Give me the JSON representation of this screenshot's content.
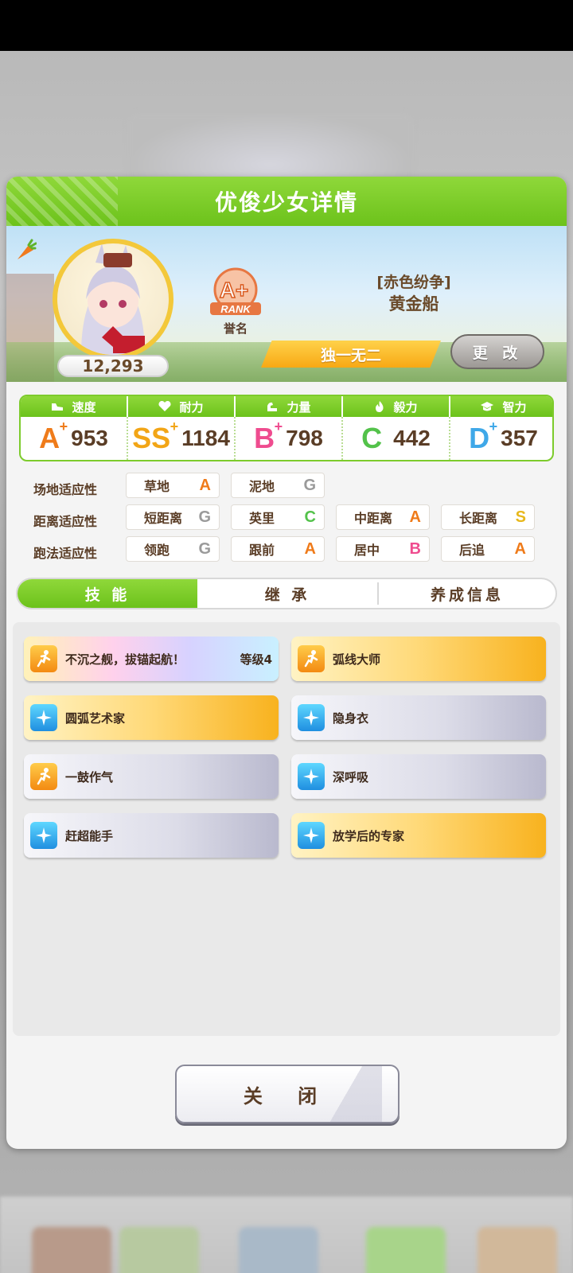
{
  "dialog": {
    "title": "优俊少女详情"
  },
  "character": {
    "fans": "12,293",
    "rank": "A+",
    "rank_word": "RANK",
    "rank_label": "誉名",
    "epithet": "[赤色纷争]",
    "name": "黄金船",
    "title_bar": "独一无二",
    "change_label": "更 改"
  },
  "stats": [
    {
      "label": "速度",
      "grade": "A",
      "plus": "+",
      "value": "953",
      "color": "#ef7b1a",
      "icon": "shoe-icon"
    },
    {
      "label": "耐力",
      "grade": "SS",
      "plus": "+",
      "value": "1184",
      "color": "#f2a516",
      "icon": "heart-icon"
    },
    {
      "label": "力量",
      "grade": "B",
      "plus": "+",
      "value": "798",
      "color": "#ef4c8f",
      "icon": "arm-icon"
    },
    {
      "label": "毅力",
      "grade": "C",
      "plus": "",
      "value": "442",
      "color": "#53c24a",
      "icon": "flame-icon"
    },
    {
      "label": "智力",
      "grade": "D",
      "plus": "+",
      "value": "357",
      "color": "#3fa8e8",
      "icon": "graduation-cap-icon"
    }
  ],
  "aptitude": {
    "rows": [
      {
        "label": "场地适应性",
        "cells": [
          {
            "name": "草地",
            "grade": "A"
          },
          {
            "name": "泥地",
            "grade": "G"
          }
        ]
      },
      {
        "label": "距离适应性",
        "cells": [
          {
            "name": "短距离",
            "grade": "G"
          },
          {
            "name": "英里",
            "grade": "C"
          },
          {
            "name": "中距离",
            "grade": "A"
          },
          {
            "name": "长距离",
            "grade": "S"
          }
        ]
      },
      {
        "label": "跑法适应性",
        "cells": [
          {
            "name": "领跑",
            "grade": "G"
          },
          {
            "name": "跟前",
            "grade": "A"
          },
          {
            "name": "居中",
            "grade": "B"
          },
          {
            "name": "后追",
            "grade": "A"
          }
        ]
      }
    ]
  },
  "tabs": [
    {
      "label": "技 能",
      "active": true
    },
    {
      "label": "继 承",
      "active": false
    },
    {
      "label": "养成信息",
      "active": false
    }
  ],
  "skills": [
    {
      "name": "不沉之舰，拔锚起航！",
      "level": "等级4",
      "style": "rainbow",
      "icon": "runner-icon",
      "icon_color": "orange"
    },
    {
      "name": "弧线大师",
      "level": "",
      "style": "gold",
      "icon": "runner-icon",
      "icon_color": "orange"
    },
    {
      "name": "圆弧艺术家",
      "level": "",
      "style": "gold",
      "icon": "sparkle-icon",
      "icon_color": "blue"
    },
    {
      "name": "隐身衣",
      "level": "",
      "style": "normal",
      "icon": "sparkle-icon",
      "icon_color": "blue"
    },
    {
      "name": "一鼓作气",
      "level": "",
      "style": "normal",
      "icon": "runner-icon",
      "icon_color": "orange"
    },
    {
      "name": "深呼吸",
      "level": "",
      "style": "normal",
      "icon": "sparkle-icon",
      "icon_color": "blue"
    },
    {
      "name": "赶超能手",
      "level": "",
      "style": "normal",
      "icon": "sparkle-icon",
      "icon_color": "blue"
    },
    {
      "name": "放学后的专家",
      "level": "",
      "style": "gold",
      "icon": "sparkle-icon",
      "icon_color": "blue"
    }
  ],
  "footer": {
    "close_label": "关 闭"
  },
  "grade_colors": {
    "A": "#ef7b1a",
    "B": "#ef4c8f",
    "C": "#53c24a",
    "S": "#e8b81c",
    "G": "#9a9a9a"
  }
}
